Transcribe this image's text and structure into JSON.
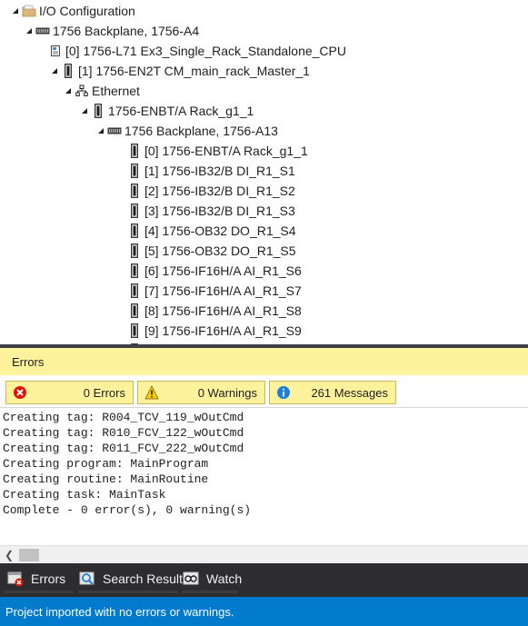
{
  "tree": {
    "items": [
      {
        "label": "I/O Configuration",
        "icon": "folder-icon",
        "expanded": true
      },
      {
        "label": "1756 Backplane, 1756-A4",
        "icon": "backplane-icon",
        "expanded": true
      },
      {
        "label": "[0] 1756-L71 Ex3_Single_Rack_Standalone_CPU",
        "icon": "controller-icon",
        "expanded": null
      },
      {
        "label": "[1] 1756-EN2T CM_main_rack_Master_1",
        "icon": "module-icon",
        "expanded": true
      },
      {
        "label": "Ethernet",
        "icon": "network-icon",
        "expanded": true
      },
      {
        "label": "1756-ENBT/A Rack_g1_1",
        "icon": "module-icon",
        "expanded": true
      },
      {
        "label": "1756 Backplane, 1756-A13",
        "icon": "backplane-icon",
        "expanded": true
      },
      {
        "label": "[0] 1756-ENBT/A Rack_g1_1",
        "icon": "module-icon",
        "expanded": null
      },
      {
        "label": "[1] 1756-IB32/B DI_R1_S1",
        "icon": "module-icon",
        "expanded": null
      },
      {
        "label": "[2] 1756-IB32/B DI_R1_S2",
        "icon": "module-icon",
        "expanded": null
      },
      {
        "label": "[3] 1756-IB32/B DI_R1_S3",
        "icon": "module-icon",
        "expanded": null
      },
      {
        "label": "[4] 1756-OB32 DO_R1_S4",
        "icon": "module-icon",
        "expanded": null
      },
      {
        "label": "[5] 1756-OB32 DO_R1_S5",
        "icon": "module-icon",
        "expanded": null
      },
      {
        "label": "[6] 1756-IF16H/A AI_R1_S6",
        "icon": "module-icon",
        "expanded": null
      },
      {
        "label": "[7] 1756-IF16H/A AI_R1_S7",
        "icon": "module-icon",
        "expanded": null
      },
      {
        "label": "[8] 1756-IF16H/A AI_R1_S8",
        "icon": "module-icon",
        "expanded": null
      },
      {
        "label": "[9] 1756-IF16H/A AI_R1_S9",
        "icon": "module-icon",
        "expanded": null
      }
    ]
  },
  "errors_panel": {
    "title": "Errors",
    "filters": {
      "errors": "0 Errors",
      "warnings": "0 Warnings",
      "messages": "261 Messages"
    },
    "output_lines": [
      "Creating tag: R004_TCV_119_wOutCmd",
      "Creating tag: R010_FCV_122_wOutCmd",
      "Creating tag: R011_FCV_222_wOutCmd",
      "Creating program: MainProgram",
      "Creating routine: MainRoutine",
      "Creating task: MainTask",
      "Complete - 0 error(s), 0 warning(s)"
    ]
  },
  "tabs": {
    "errors": "Errors",
    "search_results": "Search Results",
    "watch": "Watch"
  },
  "status": {
    "message": "Project imported with no errors or warnings."
  },
  "colors": {
    "accent": "#007acc",
    "panel_highlight": "#fff29d",
    "tab_bar": "#2d2d30",
    "error_red": "#e51400",
    "warning_yellow": "#ffcc00",
    "info_blue": "#1e7ed8"
  }
}
